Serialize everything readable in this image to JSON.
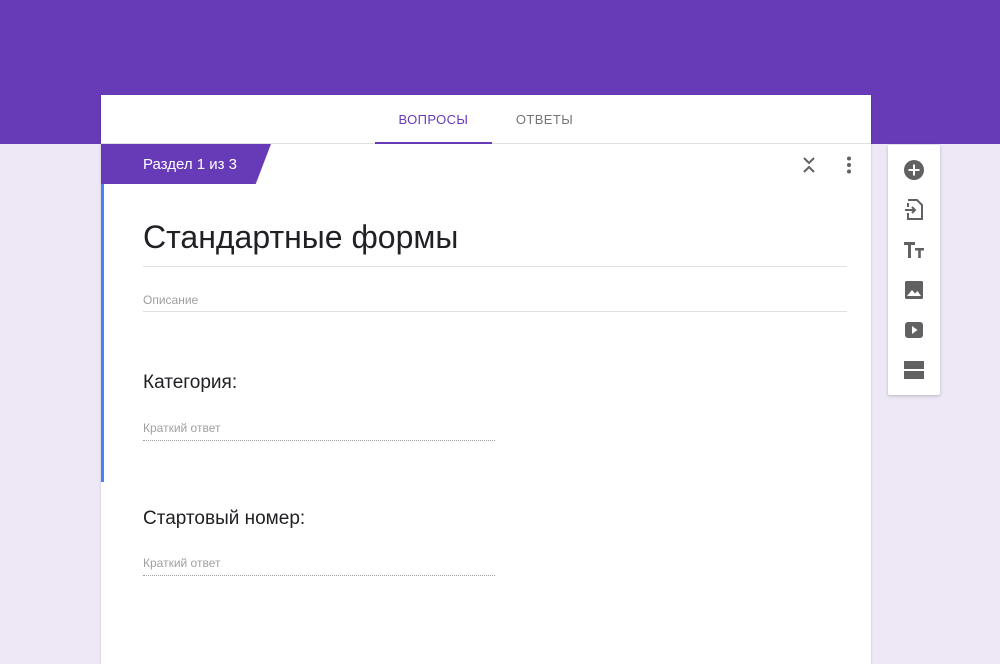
{
  "tabs": [
    {
      "label": "ВОПРОСЫ",
      "active": true
    },
    {
      "label": "ОТВЕТЫ",
      "active": false
    }
  ],
  "section": {
    "label": "Раздел 1 из 3"
  },
  "form": {
    "title": "Стандартные формы",
    "description_placeholder": "Описание"
  },
  "questions": [
    {
      "label": "Категория:",
      "answer_placeholder": "Краткий ответ"
    },
    {
      "label": "Стартовый номер:",
      "answer_placeholder": "Краткий ответ"
    }
  ],
  "card_actions": [
    "collapse-icon",
    "more-vert-icon"
  ],
  "toolbar": [
    "add-circle-icon",
    "import-question-icon",
    "title-text-icon",
    "image-icon",
    "video-icon",
    "section-icon"
  ],
  "colors": {
    "brand": "#673ab7",
    "background": "#ede7f6",
    "accent": "#4285f4",
    "icon": "#616161"
  }
}
